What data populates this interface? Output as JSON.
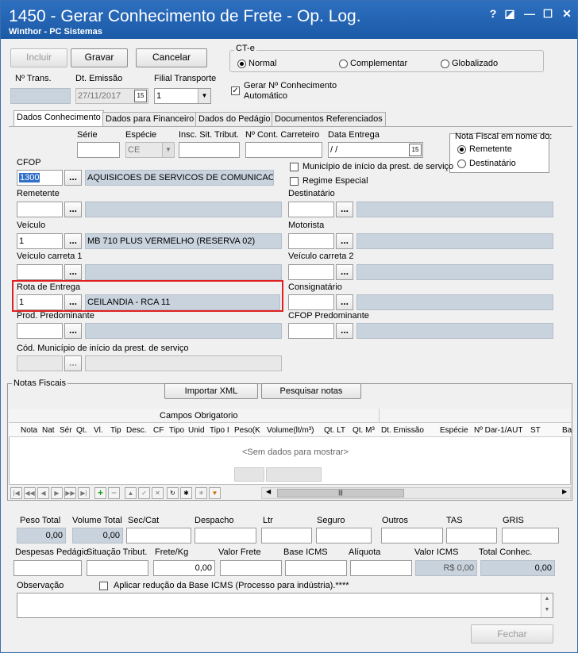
{
  "title": "1450 - Gerar Conhecimento de Frete - Op. Log.",
  "subtitle": "Winthor - PC Sistemas",
  "window_controls": {
    "help": "?",
    "restore": "◪",
    "minimize": "—",
    "maximize": "☐",
    "close": "✕"
  },
  "toolbar": {
    "incluir": "Incluir",
    "gravar": "Gravar",
    "cancelar": "Cancelar"
  },
  "cte": {
    "label": "CT-e",
    "normal": "Normal",
    "complementar": "Complementar",
    "globalizado": "Globalizado"
  },
  "header": {
    "ntrans_label": "Nº Trans.",
    "ntrans_value": "",
    "dtemissao_label": "Dt. Emissão",
    "dtemissao_value": "27/11/2017",
    "cal_icon": "15",
    "filial_label": "Filial Transporte",
    "filial_value": "1",
    "gerar_label": "Gerar Nº Conhecimento Automático",
    "gerar_checked": "✓"
  },
  "tabs": [
    "Dados Conhecimento",
    "Dados para Financeiro",
    "Dados do Pedágio",
    "Documentos Referenciados"
  ],
  "form": {
    "serie_label": "Série",
    "serie_value": "",
    "especie_label": "Espécie",
    "especie_value": "CE",
    "insc_label": "Insc. Sit. Tribut.",
    "insc_value": "",
    "ncont_label": "Nº Cont. Carreteiro",
    "ncont_value": "",
    "dataentrega_label": "Data Entrega",
    "dataentrega_value": " / /",
    "nf_group_label": "Nota Fiscal em nome do:",
    "nf_remetente": "Remetente",
    "nf_destinatario": "Destinatário",
    "cfop_label": "CFOP",
    "cfop_value": "1300",
    "cfop_desc": "AQUISICOES DE SERVICOS DE COMUNICACAO",
    "municipio_chk_label": "Município de início da prest. de serviço",
    "regime_chk_label": "Regime Especial",
    "remetente_label": "Remetente",
    "destinatario_label": "Destinatário",
    "veiculo_label": "Veículo",
    "veiculo_value": "1",
    "veiculo_desc": "MB 710 PLUS VERMELHO (RESERVA 02)",
    "motorista_label": "Motorista",
    "veiculo_carreta_label": "Veículo carreta 1",
    "veiculo_carreta2_label": "Veículo carreta 2",
    "rota_label": "Rota de Entrega",
    "rota_value": "1",
    "rota_desc": "CEILANDIA - RCA 11",
    "consignatario_label": "Consignatário",
    "prod_label": "Prod. Predominante",
    "cfop_pred_label": "CFOP Predominante",
    "cod_mun_label": "Cód. Município  de início da prest. de serviço",
    "dots": "..."
  },
  "notas": {
    "group_label": "Notas Fiscais",
    "importar": "Importar XML",
    "pesquisar": "Pesquisar notas",
    "band": "Campos Obrigatorio",
    "columns": [
      "Nota",
      "Nat",
      "Sér",
      "Qt.",
      "Vl.",
      "Tip",
      "Desc.",
      "CF",
      "Tipo",
      "Unid",
      "Tipo I",
      "Peso(K",
      "Volume(lt/m³)",
      "Qt. LT",
      "Qt. M³",
      "Dt. Emissão",
      "Espécie",
      "Nº Dar-1/AUT",
      "ST",
      "Ba"
    ],
    "empty": "<Sem dados para mostrar>",
    "nav": [
      "|◀",
      "◀◀",
      "◀",
      "▶",
      "▶▶",
      "▶|",
      "+",
      "−",
      "▲",
      "✓",
      "✕",
      "↻",
      "✱",
      "✳",
      "▼"
    ],
    "scroll_left": "◀",
    "scroll_right": "▶",
    "scroll_thumb": "|||"
  },
  "totals": {
    "peso_label": "Peso Total",
    "peso_value": "0,00",
    "volume_label": "Volume Total",
    "volume_value": "0,00",
    "seccat_label": "Sec/Cat",
    "despacho_label": "Despacho",
    "ltr_label": "Ltr",
    "seguro_label": "Seguro",
    "outros_label": "Outros",
    "tas_label": "TAS",
    "gris_label": "GRIS",
    "despesas_label": "Despesas Pedágio",
    "situacao_label": "Situação Tribut.",
    "frete_label": "Frete/Kg",
    "frete_value": "0,00",
    "valorfrete_label": "Valor Frete",
    "baseicms_label": "Base ICMS",
    "aliquota_label": "Alíquota",
    "valoricms_label": "Valor ICMS",
    "valoricms_value": "R$ 0,00",
    "totalconhec_label": "Total Conhec.",
    "totalconhec_value": "0,00"
  },
  "obs": {
    "label": "Observação",
    "aplicar_label": "Aplicar redução da Base ICMS (Processo para indústria).****"
  },
  "fechar": "Fechar",
  "highlight_color": "#e02020"
}
